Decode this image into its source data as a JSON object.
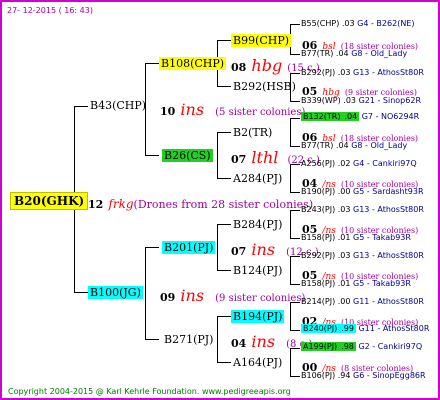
{
  "date": "27- 12-2015 ( 16: 43)",
  "footer": "Copyright 2004-2015 @ Karl Kehrle Foundation.   www.pedigreeapis.org",
  "root": {
    "label": "B20(GHK)",
    "num": "12",
    "mark": "frkg",
    "note": "(Drones from 28 sister colonies)"
  },
  "gen1": [
    {
      "label": "B43(CHP)",
      "num": "10",
      "mark": "ins",
      "note": "(5 sister colonies)"
    },
    {
      "label": "B100(JG)",
      "num": "09",
      "mark": "ins",
      "note": "(9 sister colonies)"
    }
  ],
  "gen2": [
    {
      "label": "B108(CHP)",
      "num": "08",
      "mark": "hbg",
      "note": "(15 c.)"
    },
    {
      "label": "B26(CS)",
      "num": "07",
      "mark": "lthl",
      "note": "(22 c.)"
    },
    {
      "label": "B201(PJ)",
      "num": "07",
      "mark": "ins",
      "note": "(12 c.)"
    },
    {
      "label": "B271(PJ)",
      "num": "04",
      "mark": "ins",
      "note": "(8 c.)"
    }
  ],
  "gen3": [
    {
      "label": "B99(CHP)",
      "num": "06",
      "mark": "bsl",
      "note": "(18 sister colonies)"
    },
    {
      "label": "B292(HSB)",
      "num": "05",
      "mark": "hbg",
      "note": "(9 sister colonies)"
    },
    {
      "label": "B2(TR)",
      "num": "06",
      "mark": "bsl",
      "note": "(18 sister colonies)"
    },
    {
      "label": "A284(PJ)",
      "num": "04",
      "mark": "/ns",
      "note": "(10 sister colonies)"
    },
    {
      "label": "B284(PJ)",
      "num": "05",
      "mark": "/ns",
      "note": "(10 sister colonies)"
    },
    {
      "label": "B124(PJ)",
      "num": "05",
      "mark": "/ns",
      "note": "(10 sister colonies)"
    },
    {
      "label": "B194(PJ)",
      "num": "02",
      "mark": "/ns",
      "note": "(10 sister colonies)"
    },
    {
      "label": "A164(PJ)",
      "num": "00",
      "mark": "/ns",
      "note": "(8 sister colonies)"
    }
  ],
  "gen4": [
    {
      "label": "B55(CHP)",
      "year": ".03",
      "code": "G4 - B262(NE)"
    },
    {
      "label": "B77(TR)",
      "year": ".04",
      "code": "G8 - Old_Lady"
    },
    {
      "label": "B292(PJ)",
      "year": ".03",
      "code": "G13 - AthosSt80R"
    },
    {
      "label": "B339(WP)",
      "year": ".03",
      "code": "G21 - Sinop62R"
    },
    {
      "label": "B132(TR)",
      "year": ".04",
      "code": "G7 - NO6294R"
    },
    {
      "label": "B77(TR)",
      "year": ".04",
      "code": "G8 - Old_Lady"
    },
    {
      "label": "A256(PJ)",
      "year": ".02",
      "code": "G4 - Cankiri97Q"
    },
    {
      "label": "B190(PJ)",
      "year": ".00",
      "code": "G5 - Sardasht93R"
    },
    {
      "label": "B243(PJ)",
      "year": ".03",
      "code": "G13 - AthosSt80R"
    },
    {
      "label": "B158(PJ)",
      "year": ".01",
      "code": "G5 - Takab93R"
    },
    {
      "label": "B292(PJ)",
      "year": ".03",
      "code": "G13 - AthosSt80R"
    },
    {
      "label": "B158(PJ)",
      "year": ".01",
      "code": "G5 - Takab93R"
    },
    {
      "label": "B214(PJ)",
      "year": ".00",
      "code": "G11 - AthosSt80R"
    },
    {
      "label": "B240(PJ)",
      "year": ".99",
      "code": "G11 - AthosSt80R"
    },
    {
      "label": "A199(PJ)",
      "year": ".98",
      "code": "G2 - Cankiri97Q"
    },
    {
      "label": "B106(PJ)",
      "year": ".94",
      "code": "G6 - SinopEgg86R"
    }
  ]
}
